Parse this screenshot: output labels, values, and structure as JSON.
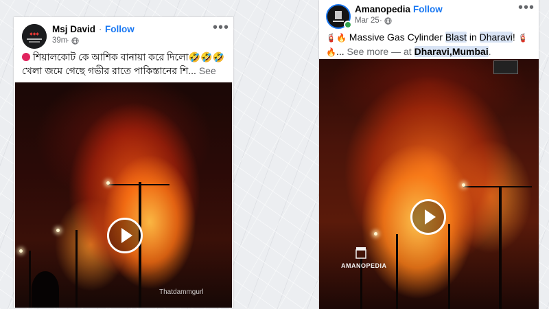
{
  "posts": [
    {
      "author": "Msj David",
      "follow_label": "Follow",
      "time": "39m",
      "line1": "শিয়ালকোট কে আশিক বানায়া করে দিলো🤣🤣🤣",
      "line2": "খেলা জমে গেছে গভীর রাতে পাকিস্তানের শি...",
      "see_more": "See more",
      "watermark": "Thatdammgurl",
      "privacy_icon": "globe-icon"
    },
    {
      "author": "Amanopedia",
      "follow_label": "Follow",
      "time": "Mar 25",
      "emoji_a": "🧯🔥",
      "text_1": "Massive Gas Cylinder",
      "hl_blast": "Blast",
      "text_2": "in",
      "hl_dharavi": "Dharavi",
      "text_3": "!",
      "emoji_b": "🧯",
      "emoji_c": "🔥",
      "ellipsis": "...",
      "see_more": "See more",
      "at_text": "— at",
      "place": "Dharavi,Mumbai",
      "period": ".",
      "watermark": "AMANOPEDIA",
      "privacy_icon": "globe-icon"
    }
  ],
  "colors": {
    "follow": "#1877f2",
    "secondary_text": "#65676b",
    "highlight": "#d9e4f5"
  }
}
